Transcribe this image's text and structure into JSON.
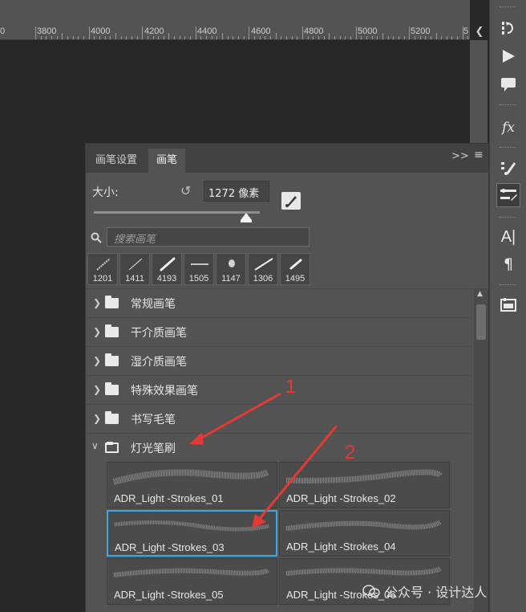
{
  "ruler": {
    "ticks": [
      "0",
      "3800",
      "4000",
      "4200",
      "4400",
      "4600",
      "4800",
      "5000",
      "5200",
      "5"
    ]
  },
  "panel": {
    "tabs": [
      {
        "label": "画笔设置",
        "active": false
      },
      {
        "label": "画笔",
        "active": true
      }
    ],
    "menu_arrows": ">>",
    "size_label": "大小:",
    "size_value": "1272 像素",
    "search_placeholder": "搜索画笔",
    "recent_brushes": [
      "1201",
      "1411",
      "4193",
      "1505",
      "1147",
      "1306",
      "1495"
    ],
    "folders": [
      {
        "label": "常规画笔",
        "expanded": false
      },
      {
        "label": "干介质画笔",
        "expanded": false
      },
      {
        "label": "湿介质画笔",
        "expanded": false
      },
      {
        "label": "特殊效果画笔",
        "expanded": false
      },
      {
        "label": "书写毛笔",
        "expanded": false
      },
      {
        "label": "灯光笔刷",
        "expanded": true
      }
    ],
    "brushes": [
      {
        "name": "ADR_Light -Strokes_01",
        "selected": false
      },
      {
        "name": "ADR_Light -Strokes_02",
        "selected": false
      },
      {
        "name": "ADR_Light -Strokes_03",
        "selected": true
      },
      {
        "name": "ADR_Light -Strokes_04",
        "selected": false
      },
      {
        "name": "ADR_Light -Strokes_05",
        "selected": false
      },
      {
        "name": "ADR_Light -Strokes_06",
        "selected": false
      }
    ]
  },
  "annotations": {
    "one": "1",
    "two": "2",
    "color": "#e53935"
  },
  "watermark": "公众号 · 设计达人",
  "colors": {
    "selection": "#3ea8e6",
    "panel_bg": "#535353",
    "canvas_bg": "#282828"
  }
}
